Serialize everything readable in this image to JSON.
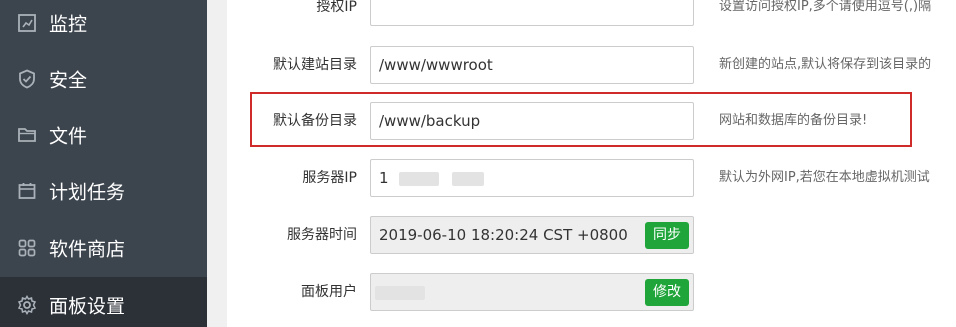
{
  "sidebar": {
    "items": [
      {
        "label": "监控",
        "icon": "monitor-icon",
        "active": false
      },
      {
        "label": "安全",
        "icon": "shield-icon",
        "active": false
      },
      {
        "label": "文件",
        "icon": "folder-icon",
        "active": false
      },
      {
        "label": "计划任务",
        "icon": "calendar-icon",
        "active": false
      },
      {
        "label": "软件商店",
        "icon": "apps-grid-icon",
        "active": false
      },
      {
        "label": "面板设置",
        "icon": "gear-icon",
        "active": true
      }
    ]
  },
  "form": {
    "auth_ip": {
      "label": "授权IP",
      "value": "",
      "hint": "设置访问授权IP,多个请使用逗号(,)隔"
    },
    "default_site_dir": {
      "label": "默认建站目录",
      "value": "/www/wwwroot",
      "hint": "新创建的站点,默认将保存到该目录的"
    },
    "default_backup_dir": {
      "label": "默认备份目录",
      "value": "/www/backup",
      "hint": "网站和数据库的备份目录!"
    },
    "server_ip": {
      "label": "服务器IP",
      "value": "1",
      "hint": "默认为外网IP,若您在本地虚拟机测试"
    },
    "server_time": {
      "label": "服务器时间",
      "value": "2019-06-10 18:20:24 CST +0800",
      "button": "同步"
    },
    "panel_user": {
      "label": "面板用户",
      "value": "",
      "button": "修改"
    }
  },
  "colors": {
    "sidebar_bg": "#3c444d",
    "sidebar_active_bg": "#2c3138",
    "accent_green": "#20a53a",
    "highlight_red": "#cf2b2b"
  }
}
